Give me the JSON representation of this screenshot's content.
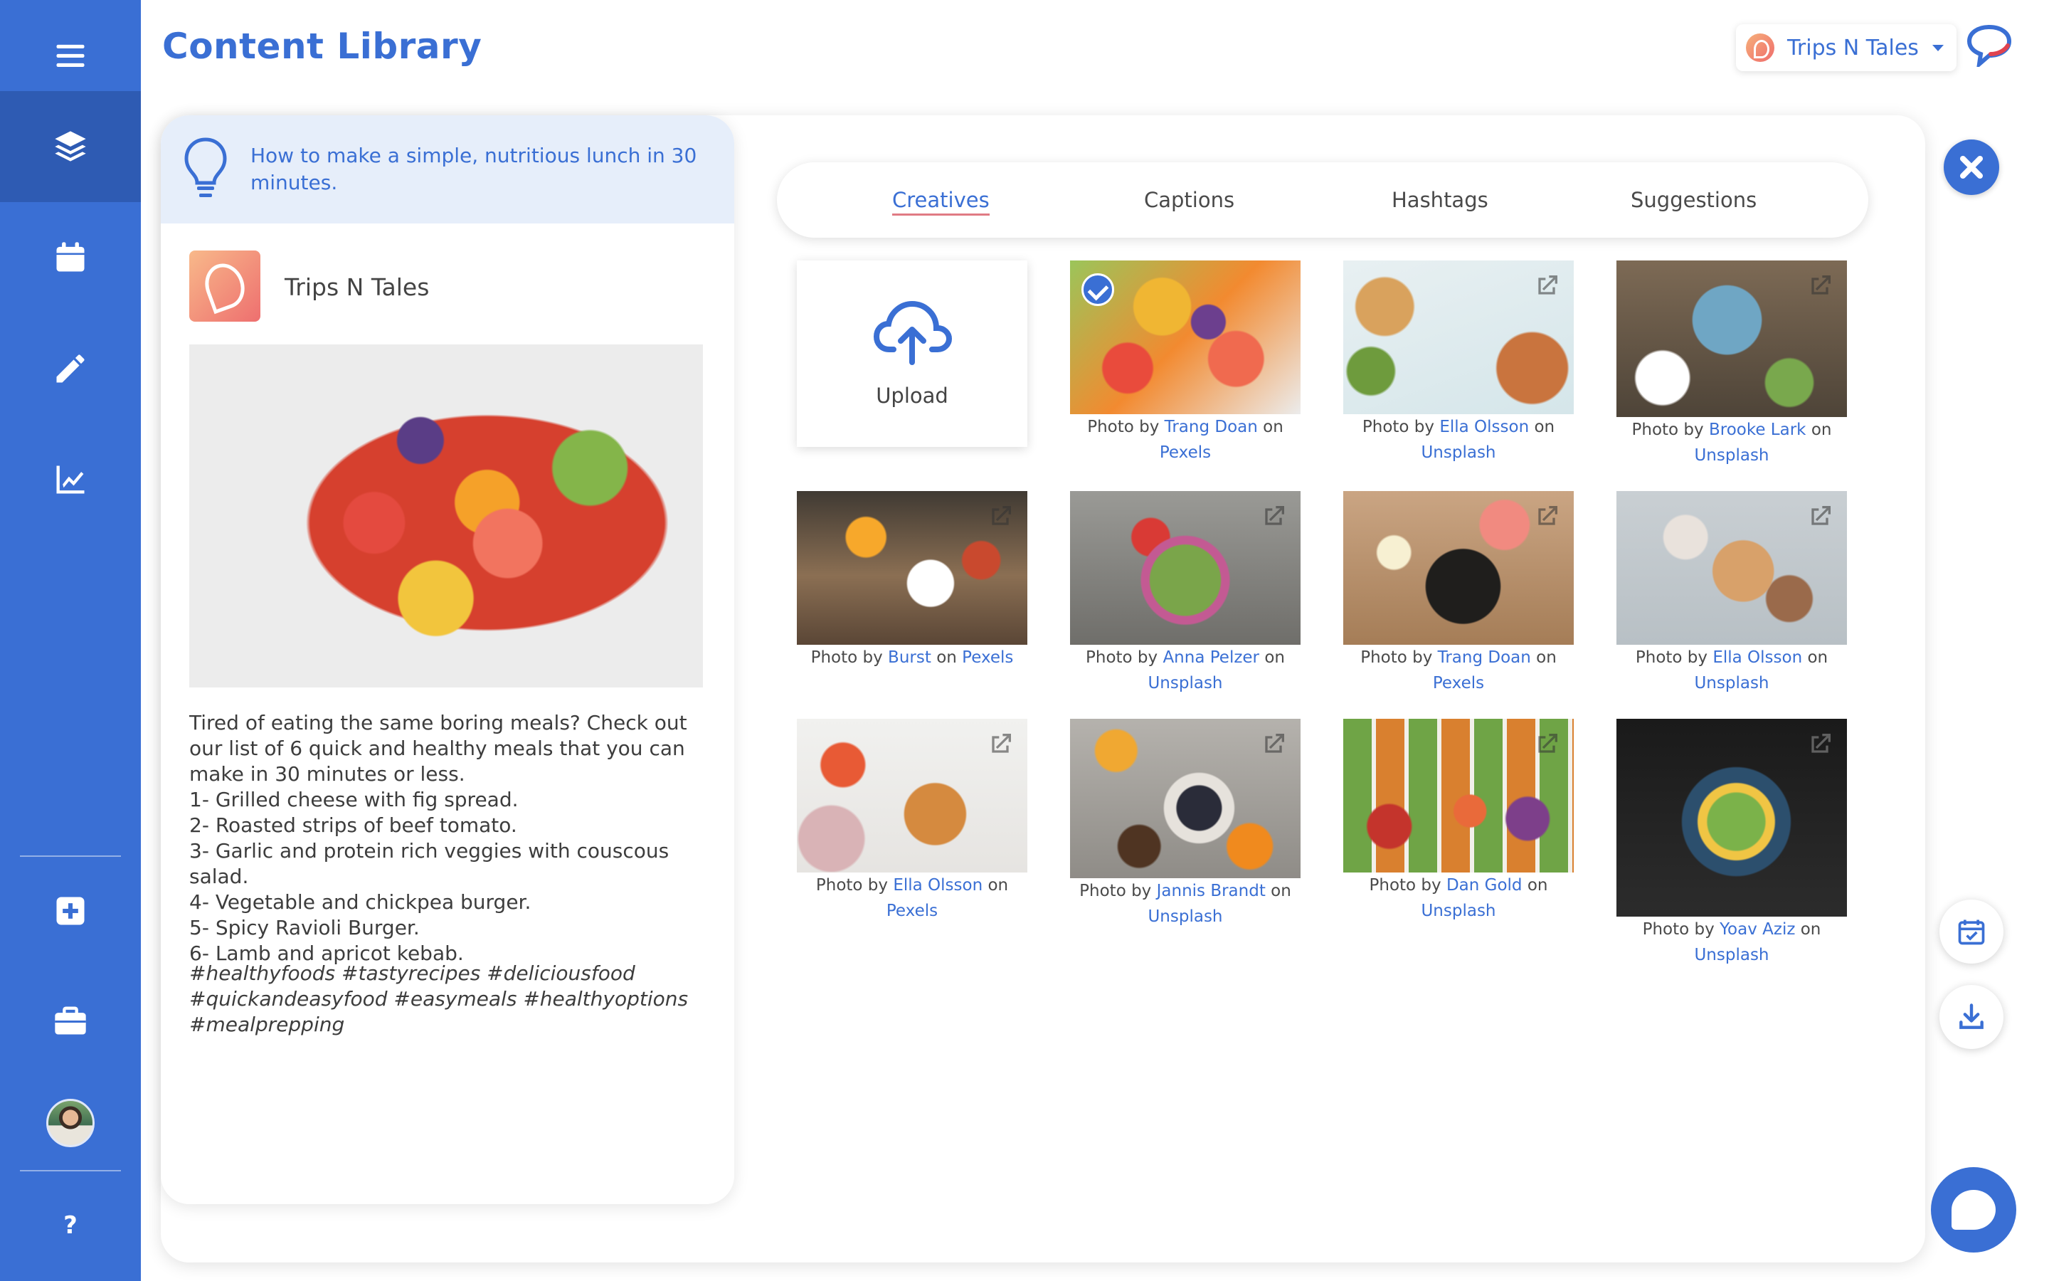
{
  "header": {
    "title": "Content Library",
    "account_name": "Trips N Tales"
  },
  "sidebar": {
    "icons": [
      "menu-icon",
      "layers-icon",
      "calendar-icon",
      "pencil-icon",
      "chart-icon",
      "add-icon",
      "briefcase-icon"
    ],
    "help_label": "?"
  },
  "preview": {
    "title": "How to make a simple, nutritious lunch in 30 minutes.",
    "brand_name": "Trips N Tales",
    "caption": "Tired of eating the same boring meals? Check out our list of 6 quick and healthy meals that you can make in 30 minutes or less.\n1- Grilled cheese with fig spread.\n2- Roasted strips of beef tomato.\n3- Garlic and protein rich veggies with couscous salad.\n4- Vegetable and chickpea burger.\n5- Spicy Ravioli Burger.\n6- Lamb and apricot kebab.",
    "hashtags": "#healthyfoods #tastyrecipes #deliciousfood #quickandeasyfood #easymeals #healthyoptions #mealprepping"
  },
  "tabs": [
    {
      "label": "Creatives",
      "active": true
    },
    {
      "label": "Captions",
      "active": false
    },
    {
      "label": "Hashtags",
      "active": false
    },
    {
      "label": "Suggestions",
      "active": false
    }
  ],
  "upload": {
    "label": "Upload"
  },
  "credit_words": {
    "photo_by": "Photo by",
    "on": "on"
  },
  "photos": [
    {
      "author": "Trang Doan",
      "source": "Pexels",
      "selected": true
    },
    {
      "author": "Ella Olsson",
      "source": "Unsplash",
      "selected": false
    },
    {
      "author": "Brooke Lark",
      "source": "Unsplash",
      "selected": false
    },
    {
      "author": "Burst",
      "source": "Pexels",
      "selected": false
    },
    {
      "author": "Anna Pelzer",
      "source": "Unsplash",
      "selected": false
    },
    {
      "author": "Trang Doan",
      "source": "Pexels",
      "selected": false
    },
    {
      "author": "Ella Olsson",
      "source": "Unsplash",
      "selected": false
    },
    {
      "author": "Ella Olsson",
      "source": "Pexels",
      "selected": false
    },
    {
      "author": "Jannis Brandt",
      "source": "Unsplash",
      "selected": false
    },
    {
      "author": "Dan Gold",
      "source": "Unsplash",
      "selected": false
    },
    {
      "author": "Yoav Aziz",
      "source": "Unsplash",
      "selected": false
    }
  ],
  "colors": {
    "primary": "#3a6fd4",
    "sidebar_active": "#2e5bb3",
    "preview_header": "#e6eefa"
  }
}
